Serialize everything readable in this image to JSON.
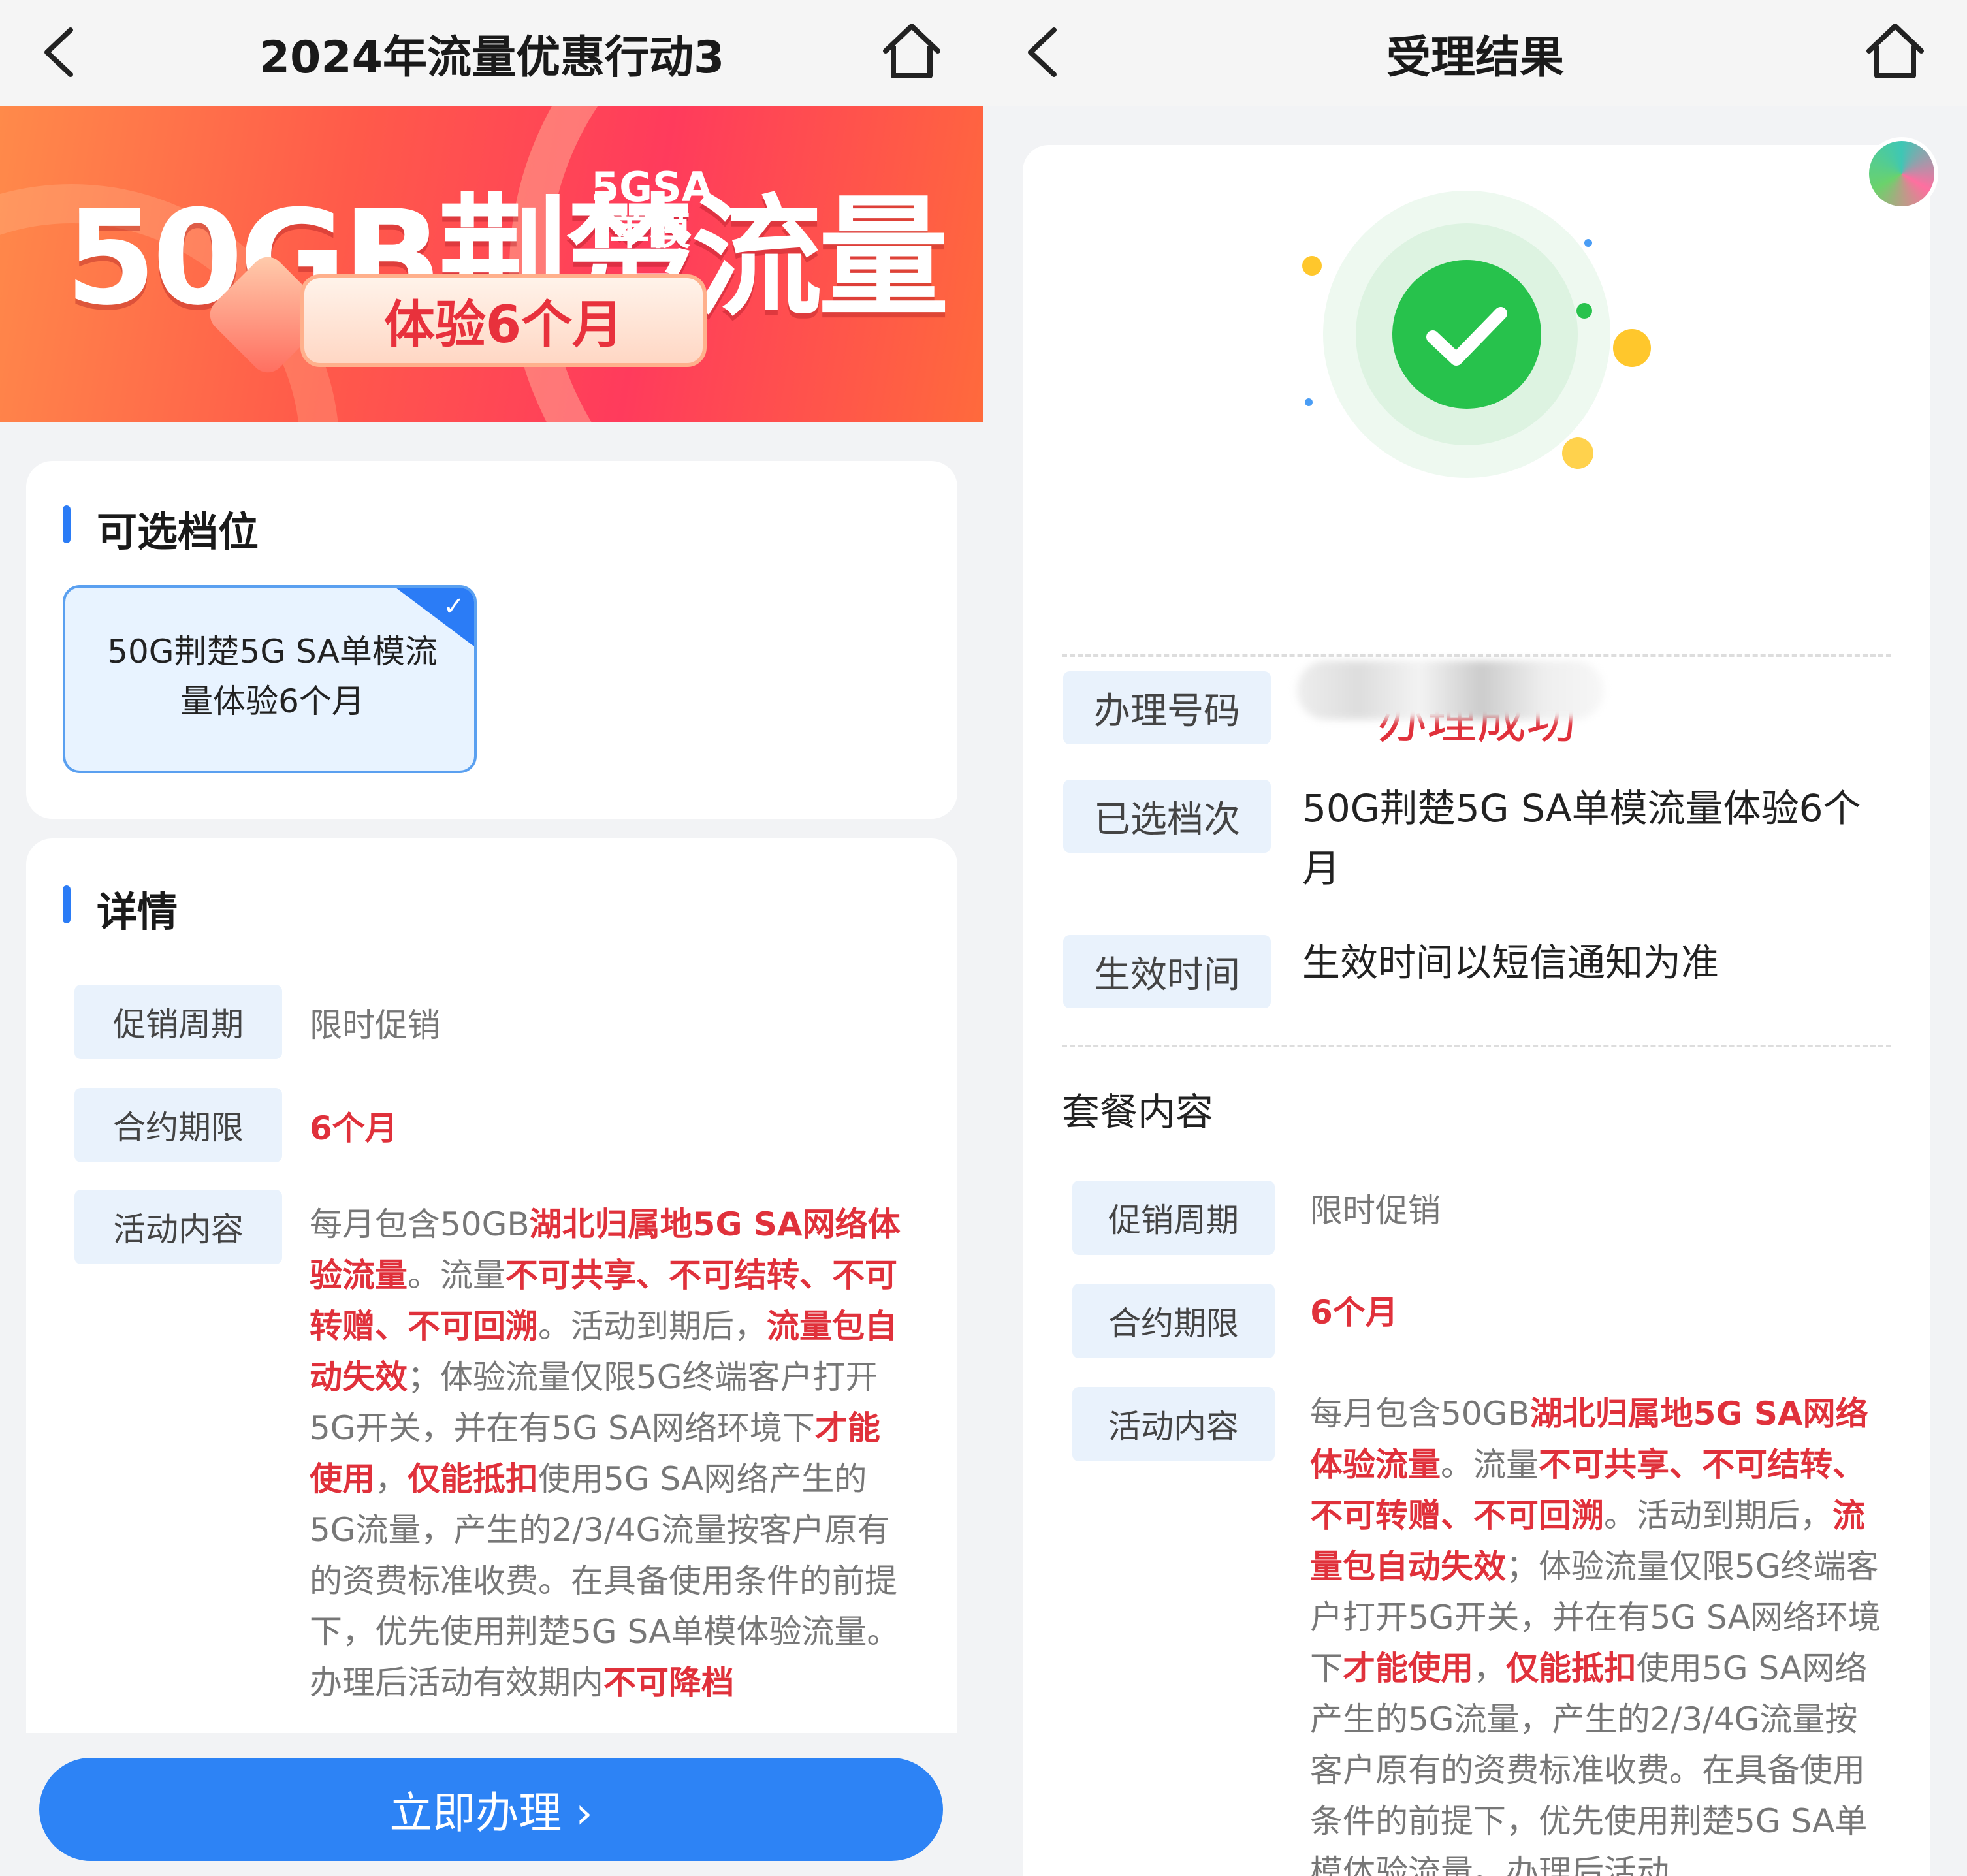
{
  "left": {
    "nav": {
      "title": "2024年流量优惠行动3"
    },
    "banner": {
      "headline": "50GB荆楚流量",
      "badge_line1": "5GSA",
      "badge_line2": "单模",
      "subtitle": "体验6个月"
    },
    "options": {
      "title": "可选档位",
      "selected_label": "50G荆楚5G SA单模流量体验6个月"
    },
    "details": {
      "title": "详情",
      "rows": [
        {
          "label": "促销周期",
          "value": "限时促销"
        },
        {
          "label": "合约期限",
          "value": "6个月"
        },
        {
          "label": "活动内容"
        }
      ],
      "content_segments": [
        {
          "t": "每月包含50GB",
          "h": false
        },
        {
          "t": "湖北归属地5G SA网络体验流量",
          "h": true
        },
        {
          "t": "。流量",
          "h": false
        },
        {
          "t": "不可共享、不可结转、不可转赠、不可回溯",
          "h": true
        },
        {
          "t": "。活动到期后，",
          "h": false
        },
        {
          "t": "流量包自动失效",
          "h": true
        },
        {
          "t": "；体验流量仅限5G终端客户打开5G开关，并在有5G SA网络环境下",
          "h": false
        },
        {
          "t": "才能使用",
          "h": true
        },
        {
          "t": "，",
          "h": false
        },
        {
          "t": "仅能抵扣",
          "h": true
        },
        {
          "t": "使用5G SA网络产生的5G流量，产生的2/3/4G流量按客户原有的资费标准收费。在具备使用条件的前提下，优先使用荆楚5G SA单模体验流量。办理后活动有效期内",
          "h": false
        },
        {
          "t": "不可降档",
          "h": true
        }
      ]
    },
    "cta": {
      "label": "立即办理 ›"
    }
  },
  "right": {
    "nav": {
      "title": "受理结果"
    },
    "status": "办理成功",
    "info": [
      {
        "label": "办理号码",
        "value": ""
      },
      {
        "label": "已选档次",
        "value": "50G荆楚5G SA单模流量体验6个月"
      },
      {
        "label": "生效时间",
        "value": "生效时间以短信通知为准"
      }
    ],
    "package_title": "套餐内容",
    "package_rows": [
      {
        "label": "促销周期",
        "value": "限时促销"
      },
      {
        "label": "合约期限",
        "value": "6个月"
      },
      {
        "label": "活动内容"
      }
    ],
    "content_segments": [
      {
        "t": "每月包含50GB",
        "h": false
      },
      {
        "t": "湖北归属地5G SA网络体验流量",
        "h": true
      },
      {
        "t": "。流量",
        "h": false
      },
      {
        "t": "不可共享、不可结转、不可转赠、不可回溯",
        "h": true
      },
      {
        "t": "。活动到期后，",
        "h": false
      },
      {
        "t": "流量包自动失效",
        "h": true
      },
      {
        "t": "；体验流量仅限5G终端客户打开5G开关，并在有5G SA网络环境下",
        "h": false
      },
      {
        "t": "才能使用",
        "h": true
      },
      {
        "t": "，",
        "h": false
      },
      {
        "t": "仅能抵扣",
        "h": true
      },
      {
        "t": "使用5G SA网络产生的5G流量，产生的2/3/4G流量按客户原有的资费标准收费。在具备使用条件的前提下，优先使用荆楚5G SA单模体验流量。办理后活动",
        "h": false
      }
    ]
  },
  "colors": {
    "accent": "#2b7cf6",
    "highlight": "#e0313b",
    "success": "#27c24c"
  },
  "icons": {
    "back": "chevron-left-icon",
    "home": "home-icon",
    "success": "check-circle-icon"
  }
}
